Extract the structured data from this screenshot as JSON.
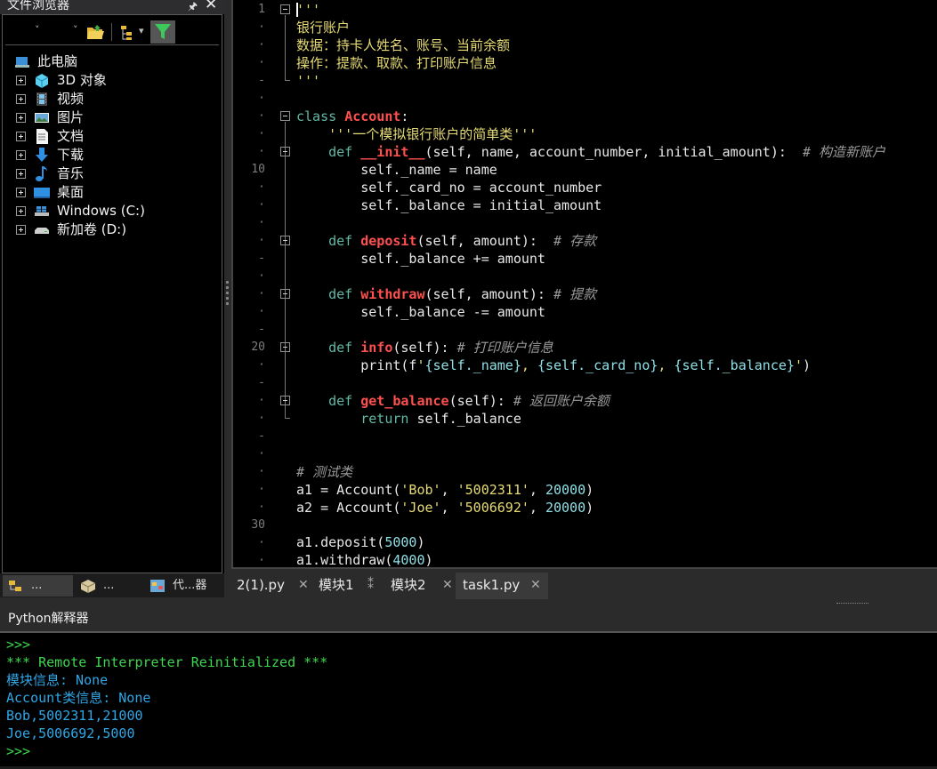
{
  "file_browser": {
    "title": "文件浏览器",
    "pin_glyph": "🖈",
    "close_glyph": "✕",
    "toolbar": {
      "dropdown1_glyph": "˅",
      "dropdown2_glyph": "˅",
      "dropdown3_glyph": "▾"
    },
    "tree": {
      "root": "此电脑",
      "items": [
        "3D 对象",
        "视频",
        "图片",
        "文档",
        "下载",
        "音乐",
        "桌面",
        "Windows (C:)",
        "新加卷 (D:)"
      ]
    },
    "tabs": [
      {
        "label": "..."
      },
      {
        "label": "..."
      },
      {
        "label": "代...器"
      }
    ]
  },
  "editor": {
    "line_markers": [
      "1",
      "·",
      "·",
      "·",
      "-",
      "·",
      "·",
      "·",
      "·",
      "10",
      "·",
      "·",
      "·",
      "·",
      "-",
      "·",
      "·",
      "·",
      "-",
      "20",
      "·",
      "-",
      "·",
      "·",
      "-",
      "·",
      "·",
      "·",
      "·",
      "30",
      "·",
      "·"
    ],
    "tabs": [
      {
        "label": "2(1).py",
        "close": "✕"
      },
      {
        "label": "模块1",
        "close": "⁑"
      },
      {
        "label": "模块2",
        "close": "✕"
      },
      {
        "label": "task1.py",
        "close": "✕"
      }
    ]
  },
  "interpreter": {
    "title": "Python解释器",
    "lines": [
      ">>>",
      "*** Remote Interpreter Reinitialized ***",
      "模块信息: None",
      "Account类信息: None",
      "Bob,5002311,21000",
      "Joe,5006692,5000",
      ">>>"
    ]
  },
  "colors": {
    "keyword": "#62b9a5",
    "definition": "#ff5050",
    "string": "#e6db74",
    "comment": "#9a9a9a",
    "number": "#8fe0e6",
    "console_green": "#3fd64f",
    "console_blue": "#2fa6e6"
  }
}
